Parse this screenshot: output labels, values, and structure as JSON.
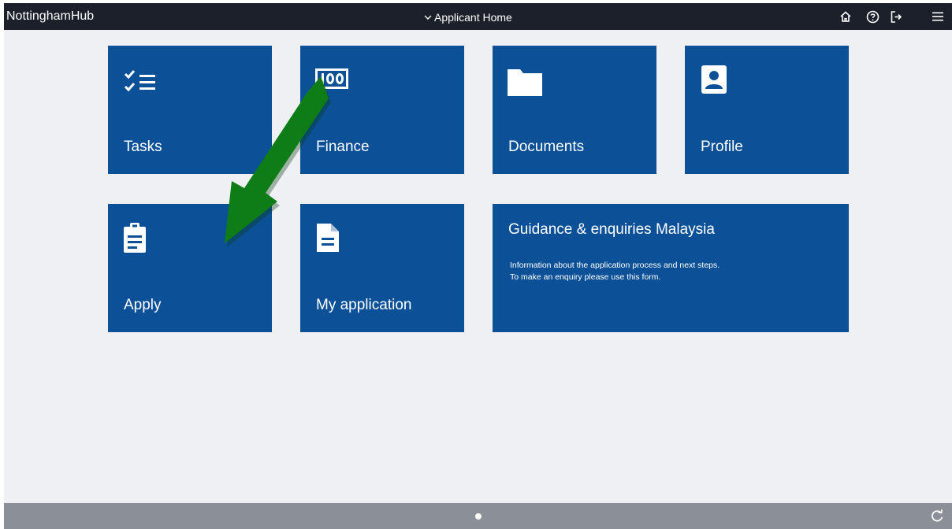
{
  "header": {
    "brand": "NottinghamHub",
    "page_title": "Applicant Home",
    "icons": [
      "home-icon",
      "help-icon",
      "logout-icon",
      "menu-icon"
    ]
  },
  "tiles": {
    "tasks": {
      "label": "Tasks",
      "icon": "checklist-icon"
    },
    "finance": {
      "label": "Finance",
      "icon": "money-icon"
    },
    "documents": {
      "label": "Documents",
      "icon": "folder-icon"
    },
    "profile": {
      "label": "Profile",
      "icon": "person-icon"
    },
    "apply": {
      "label": "Apply",
      "icon": "clipboard-icon"
    },
    "my_application": {
      "label": "My application",
      "icon": "document-icon"
    },
    "guidance": {
      "title": "Guidance & enquiries Malaysia",
      "line1": "Information about the application process and next steps.",
      "line2": "To make an enquiry please use this form."
    }
  },
  "footer": {
    "icon": "refresh-icon"
  },
  "colors": {
    "topbar": "#1b202a",
    "tile": "#0c5197",
    "background": "#eff0f4",
    "footer": "#8a8f98",
    "annotation_arrow": "#0f7d17"
  }
}
